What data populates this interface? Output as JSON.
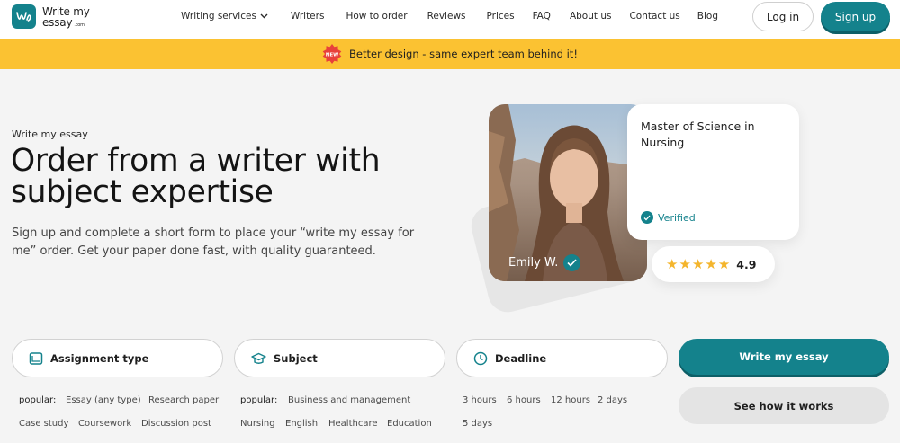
{
  "brand": {
    "line1": "Write my",
    "line2": "essay",
    "suffix": ".com"
  },
  "nav": {
    "items": [
      "Writing services",
      "Writers",
      "How to order",
      "Reviews",
      "Prices",
      "FAQ",
      "About us",
      "Contact us",
      "Blog"
    ],
    "login": "Log in",
    "signup": "Sign up"
  },
  "banner": {
    "badge": "NEW",
    "text": "Better design - same expert team behind it!"
  },
  "hero": {
    "kicker": "Write my essay",
    "title": "Order from a writer with subject expertise",
    "subtitle": "Sign up and complete a short form to place your “write my essay for me” order. Get your paper done fast, with quality guaranteed."
  },
  "writer": {
    "name": "Emily W.",
    "degree": "Master of Science in Nursing",
    "verified": "Verified",
    "rating": "4.9",
    "stars": 5
  },
  "form": {
    "assignment": {
      "label": "Assignment type",
      "popular_label": "popular:",
      "options": [
        "Essay (any type)",
        "Research paper",
        "Case study",
        "Coursework",
        "Discussion post"
      ]
    },
    "subject": {
      "label": "Subject",
      "popular_label": "popular:",
      "options": [
        "Business and management",
        "Nursing",
        "English",
        "Healthcare",
        "Education"
      ]
    },
    "deadline": {
      "label": "Deadline",
      "options": [
        "3 hours",
        "6 hours",
        "12 hours",
        "2 days",
        "5 days"
      ]
    },
    "primary_button": "Write my essay",
    "secondary_button": "See how it works"
  },
  "colors": {
    "accent": "#14828c",
    "banner": "#fbc232",
    "star": "#f4b52c",
    "background": "#f4f4f4"
  }
}
